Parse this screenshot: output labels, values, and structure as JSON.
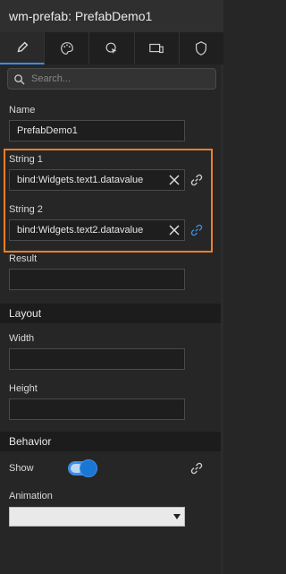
{
  "window": {
    "title": "wm-prefab: PrefabDemo1"
  },
  "tabs": [
    {
      "icon": "pencil-icon",
      "active": true
    },
    {
      "icon": "palette-icon",
      "active": false
    },
    {
      "icon": "cursor-gear-icon",
      "active": false
    },
    {
      "icon": "devices-icon",
      "active": false
    },
    {
      "icon": "shield-icon",
      "active": false
    }
  ],
  "search": {
    "placeholder": "Search..."
  },
  "properties": {
    "name": {
      "label": "Name",
      "value": "PrefabDemo1"
    },
    "string1": {
      "label": "String 1",
      "value": "bind:Widgets.text1.datavalue"
    },
    "string2": {
      "label": "String 2",
      "value": "bind:Widgets.text2.datavalue"
    },
    "result": {
      "label": "Result",
      "value": ""
    }
  },
  "layout": {
    "title": "Layout",
    "width": {
      "label": "Width",
      "value": ""
    },
    "height": {
      "label": "Height",
      "value": ""
    }
  },
  "behavior": {
    "title": "Behavior",
    "show": {
      "label": "Show",
      "on": true
    },
    "animation": {
      "label": "Animation",
      "value": ""
    }
  },
  "colors": {
    "accent": "#3a8ee6",
    "highlight": "#f07f2a",
    "bound_link": "#3a8ee6"
  }
}
